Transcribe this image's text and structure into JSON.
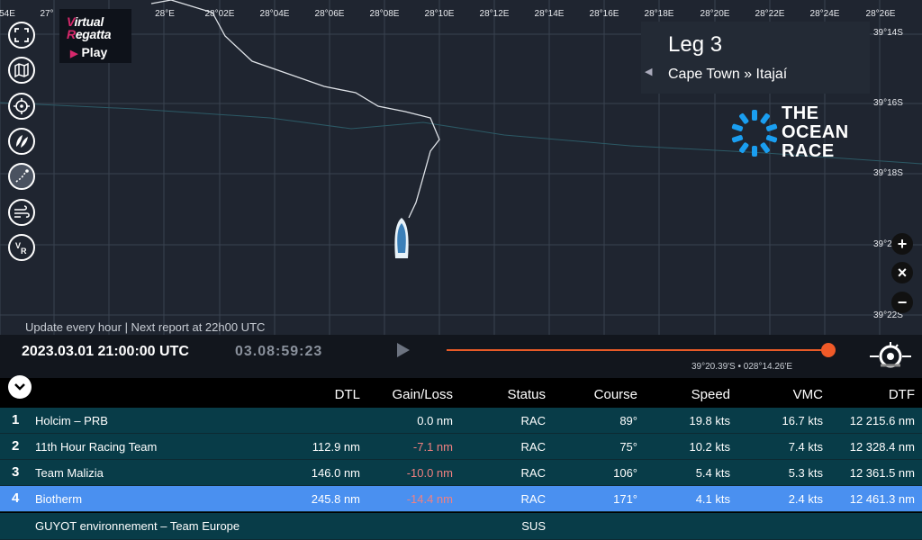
{
  "map": {
    "lon_labels": [
      "54E",
      "27°",
      "28°E",
      "28°02E",
      "28°04E",
      "28°06E",
      "28°08E",
      "28°10E",
      "28°12E",
      "28°14E",
      "28°16E",
      "28°18E",
      "28°20E",
      "28°22E",
      "28°24E",
      "28°26E"
    ],
    "lat_labels": [
      "39°14S",
      "39°16S",
      "39°18S",
      "39°2",
      "39°22S"
    ],
    "icons": [
      "fullscreen-icon",
      "map-icon",
      "crosshair-icon",
      "sails-icon",
      "route-icon",
      "wind-icon",
      "vr-icon"
    ]
  },
  "logo": {
    "line1": "Virtual",
    "line2": "Regatta",
    "play": "Play"
  },
  "leg": {
    "title": "Leg 3",
    "route": "Cape Town » Itajaí"
  },
  "ocean_race": {
    "line1": "THE",
    "line2": "OCEAN",
    "line3": "RACE"
  },
  "zoom": {
    "in": "+",
    "reset": "×",
    "out": "−"
  },
  "timeline": {
    "update_text": "Update every hour | Next report at  22h00  UTC",
    "datetime": "2023.03.01 21:00:00 UTC",
    "elapsed": "03.08:59:23",
    "progress": 1.0,
    "coords": "39°20.39'S • 028°14.26'E"
  },
  "table": {
    "headers": [
      "DTL",
      "Gain/Loss",
      "Status",
      "Course",
      "Speed",
      "VMC",
      "DTF"
    ],
    "rows": [
      {
        "rank": "1",
        "name": "Holcim – PRB",
        "dtl": "",
        "gain": "0.0 nm",
        "status": "RAC",
        "course": "89°",
        "speed": "19.8 kts",
        "vmc": "16.7 kts",
        "dtf": "12 215.6 nm"
      },
      {
        "rank": "2",
        "name": "11th Hour Racing Team",
        "dtl": "112.9 nm",
        "gain": "-7.1 nm",
        "status": "RAC",
        "course": "75°",
        "speed": "10.2 kts",
        "vmc": "7.4 kts",
        "dtf": "12 328.4 nm"
      },
      {
        "rank": "3",
        "name": "Team Malizia",
        "dtl": "146.0 nm",
        "gain": "-10.0 nm",
        "status": "RAC",
        "course": "106°",
        "speed": "5.4 kts",
        "vmc": "5.3 kts",
        "dtf": "12 361.5 nm"
      },
      {
        "rank": "4",
        "name": "Biotherm",
        "dtl": "245.8 nm",
        "gain": "-14.4 nm",
        "status": "RAC",
        "course": "171°",
        "speed": "4.1 kts",
        "vmc": "2.4 kts",
        "dtf": "12 461.3 nm"
      },
      {
        "rank": "",
        "name": "GUYOT environnement – Team Europe",
        "dtl": "",
        "gain": "",
        "status": "SUS",
        "course": "",
        "speed": "",
        "vmc": "",
        "dtf": ""
      }
    ]
  },
  "colors": {
    "accent": "#f05a28",
    "selected_row": "#4a90f0",
    "row": "#083c48",
    "logo_pink": "#d6286b",
    "ocean_blue": "#1a9ef0"
  }
}
